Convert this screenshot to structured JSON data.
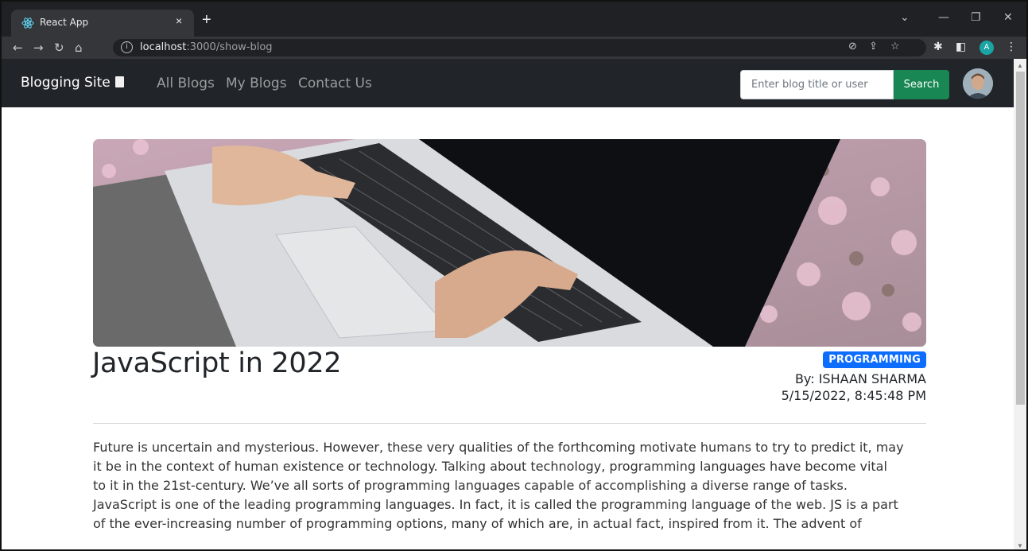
{
  "browser": {
    "tab_title": "React App",
    "tab_close": "×",
    "new_tab": "+",
    "url_host": "localhost",
    "url_path": ":3000/show-blog",
    "profile_initial": "A"
  },
  "navbar": {
    "brand": "Blogging Site",
    "links": [
      "All Blogs",
      "My Blogs",
      "Contact Us"
    ],
    "search_placeholder": "Enter blog title or user",
    "search_button": "Search"
  },
  "post": {
    "title": "JavaScript in 2022",
    "category": "PROGRAMMING",
    "author": "By: ISHAAN SHARMA",
    "datetime": "5/15/2022, 8:45:48 PM",
    "body_lines": [
      "Future is uncertain and mysterious. However, these very qualities of the forthcoming motivate humans to try to predict it, may",
      "it be in the context of human existence or technology. Talking about technology, programming languages have become vital",
      "to it in the 21st-century. We’ve all sorts of programming languages capable of accomplishing a diverse range of tasks.",
      "JavaScript is one of the leading programming languages. In fact, it is called the programming language of the web. JS is a part",
      "of the ever-increasing number of programming options, many of which are, in actual fact, inspired from it. The advent of"
    ]
  },
  "colors": {
    "navbar_bg": "#212529",
    "search_button": "#198754",
    "badge": "#0d6efd"
  }
}
